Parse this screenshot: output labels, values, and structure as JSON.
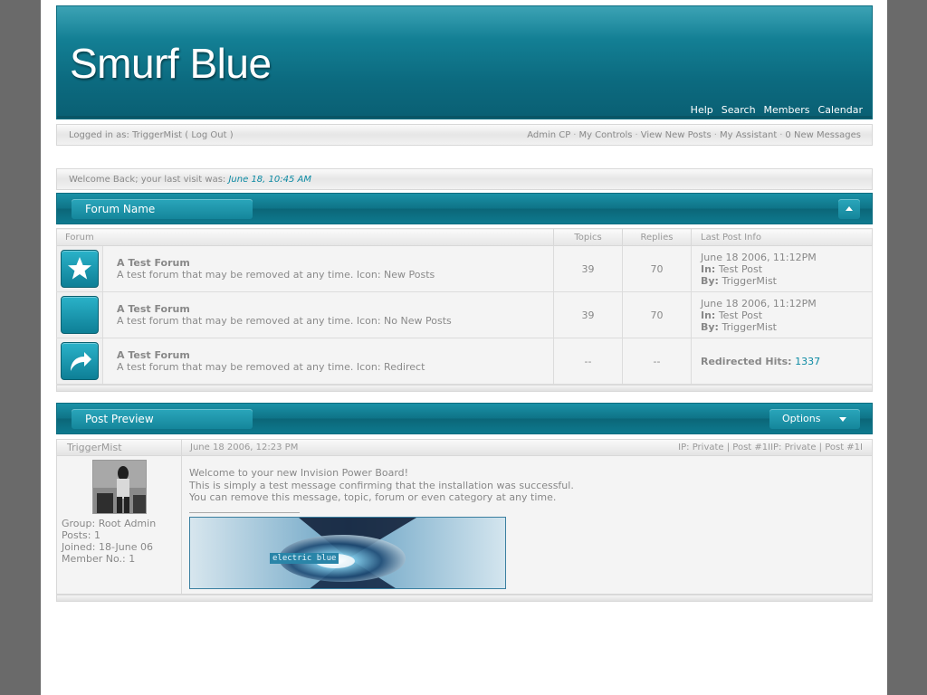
{
  "site": {
    "logo": "Smurf Blue",
    "nav": [
      "Help",
      "Search",
      "Members",
      "Calendar"
    ]
  },
  "userbar": {
    "logged_in": "Logged in as: TriggerMist ( Log Out )",
    "links": [
      "Admin CP",
      "My Controls",
      "View New Posts",
      "My Assistant",
      "0 New Messages"
    ],
    "separator": "·"
  },
  "welcome": {
    "text": "Welcome Back; your last visit was:",
    "date": "June 18, 10:45 AM"
  },
  "category": {
    "name": "Forum Name",
    "columns": [
      "Forum",
      "Topics",
      "Replies",
      "Last Post Info"
    ],
    "forums": [
      {
        "icon": "star-icon",
        "title": "A Test Forum",
        "desc": "A test forum that may be removed at any time. Icon: New Posts",
        "topics": "39",
        "replies": "70",
        "last_date": "June 18 2006, 11:12PM",
        "in_label": "In:",
        "in_value": "Test Post",
        "by_label": "By:",
        "by_value": "TriggerMist"
      },
      {
        "icon": "no-new-posts-icon",
        "title": "A Test Forum",
        "desc": "A test forum that may be removed at any time. Icon: No New Posts",
        "topics": "39",
        "replies": "70",
        "last_date": "June 18 2006, 11:12PM",
        "in_label": "In:",
        "in_value": "Test Post",
        "by_label": "By:",
        "by_value": "TriggerMist"
      },
      {
        "icon": "redirect-arrow-icon",
        "title": "A Test Forum",
        "desc": "A test forum that may be removed at any time. Icon: Redirect",
        "topics": "--",
        "replies": "--",
        "hits_label": "Redirected Hits:",
        "hits_value": "1337"
      }
    ]
  },
  "post_preview": {
    "title": "Post Preview",
    "options_label": "Options",
    "author": "TriggerMist",
    "date": "June 18 2006, 12:23 PM",
    "ip": "IP: Private | Post #1IIP: Private | Post #1I",
    "group": "Group: Root Admin",
    "posts": "Posts: 1",
    "joined": "Joined: 18-June 06",
    "member_no": "Member No.: 1",
    "message_lines": [
      "Welcome to your new Invision Power Board!",
      "This is simply a test message confirming that the installation was successful.",
      "You can remove this message, topic, forum or even category at any time."
    ],
    "signature_text": "electric blue"
  },
  "colors": {
    "accent": "#0c8aa3",
    "header_dark": "#0a5f73",
    "header_light": "#1c93a8",
    "page_bg": "#6a6a6a"
  }
}
